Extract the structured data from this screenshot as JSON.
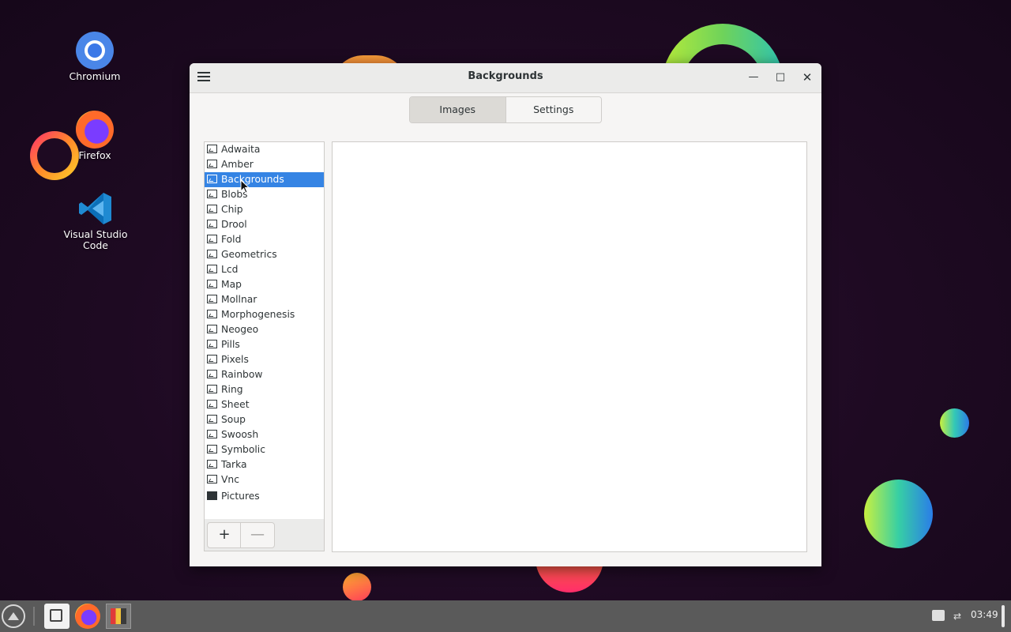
{
  "desktop": {
    "icons": [
      {
        "label": "Chromium",
        "icon": "chromium-icon"
      },
      {
        "label": "Firefox",
        "icon": "firefox-icon"
      },
      {
        "label": "Visual Studio Code",
        "icon": "vscode-icon"
      }
    ]
  },
  "window": {
    "title": "Backgrounds",
    "menu_icon": "hamburger-menu-icon",
    "controls": {
      "minimize": "minimize-icon",
      "maximize": "maximize-icon",
      "close": "close-icon"
    },
    "tabs": [
      {
        "label": "Images",
        "active": true
      },
      {
        "label": "Settings",
        "active": false
      }
    ],
    "folders": [
      "Adwaita",
      "Amber",
      "Backgrounds",
      "Blobs",
      "Chip",
      "Drool",
      "Fold",
      "Geometrics",
      "Lcd",
      "Map",
      "Mollnar",
      "Morphogenesis",
      "Neogeo",
      "Pills",
      "Pixels",
      "Rainbow",
      "Ring",
      "Sheet",
      "Soup",
      "Swoosh",
      "Symbolic",
      "Tarka",
      "Vnc"
    ],
    "selected_folder": "Backgrounds",
    "extra_item": "Pictures",
    "add_button": "+",
    "remove_button": "—"
  },
  "taskbar": {
    "apps": [
      "start-menu-icon",
      "file-manager-icon",
      "firefox-icon",
      "backgrounds-app-icon"
    ],
    "tray": [
      "printer-icon",
      "network-icon"
    ],
    "clock": "03:49"
  },
  "colors": {
    "selection": "#3584e4",
    "taskbar": "#5a5a5a",
    "desktop": "#1e0a22"
  }
}
